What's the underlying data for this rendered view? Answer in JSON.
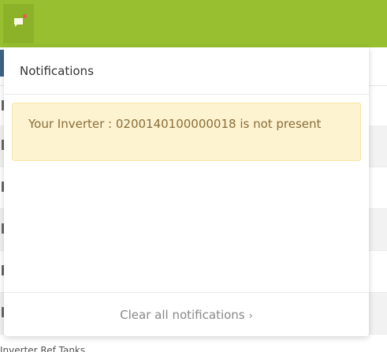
{
  "topbar": {
    "bg_color": "#97bf2f"
  },
  "notifications": {
    "title": "Notifications",
    "items": [
      {
        "message": "Your Inverter : 0200140100000018 is not present"
      }
    ],
    "clear_label": "Clear all notifications",
    "chevron": "›"
  },
  "background": {
    "footer_text": "Inverter Ref Tanks"
  },
  "icons": {
    "notification": "chat-bubble-icon",
    "badge": "notification-dot-icon",
    "chevron": "chevron-right-icon"
  }
}
